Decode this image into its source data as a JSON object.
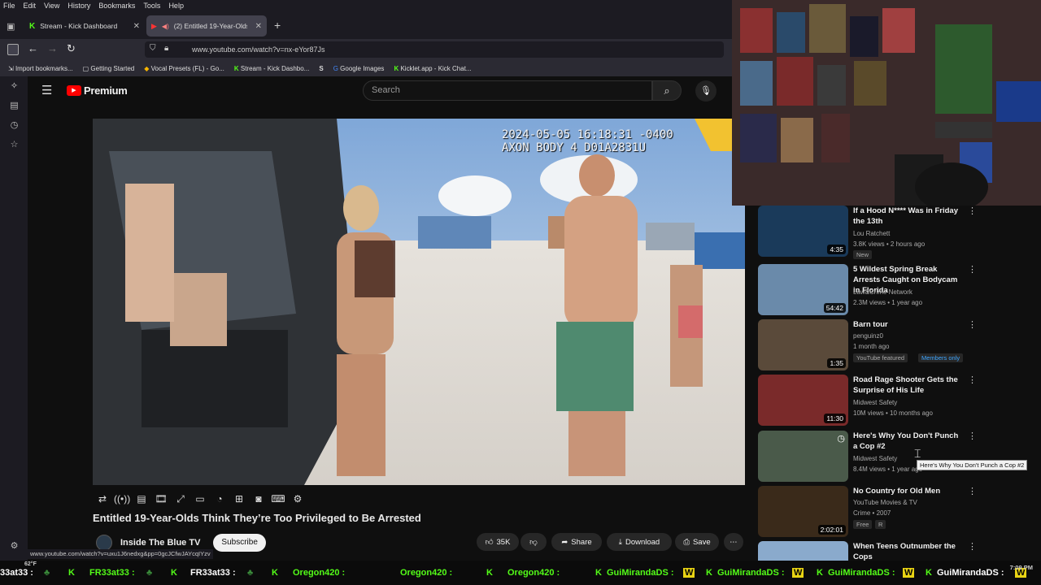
{
  "menubar": [
    "File",
    "Edit",
    "View",
    "History",
    "Bookmarks",
    "Tools",
    "Help"
  ],
  "tabs": [
    {
      "label": "Stream - Kick Dashboard"
    },
    {
      "label": "(2) Entitled 19-Year-Olds Th"
    }
  ],
  "url": "www.youtube.com/watch?v=nx-eYor87Js",
  "bookmarks": [
    "Import bookmarks...",
    "Getting Started",
    "Vocal Presets (FL) - Go...",
    "Stream - Kick Dashbo...",
    "Google Images",
    "Kicklet.app - Kick Chat..."
  ],
  "youtube": {
    "logo_text": "Premium",
    "search_placeholder": "Search"
  },
  "video": {
    "timestamp_line1": "2024-05-05 16:18:31 -0400",
    "timestamp_line2": "AXON BODY 4 D01A2831U",
    "title": "Entitled 19-Year-Olds Think They’re Too Privileged to Be Arrested",
    "channel": "Inside The Blue TV",
    "subscribe": "Subscribe",
    "likes": "35K",
    "share": "Share",
    "download": "Download",
    "save": "Save"
  },
  "status_url": "www.youtube.com/watch?v=uxu1J6nedxg&pp=0gcJCfwJAYcqIYzv",
  "recommendations": [
    {
      "title": "If a Hood N**** Was in Friday the 13th",
      "channel": "Lou Ratchett",
      "stats": "3.8K views • 2 hours ago",
      "duration": "4:35",
      "badge": "New"
    },
    {
      "title": "5 Wildest Spring Break Arrests Caught on Bodycam in Florida",
      "channel": "Law&Crime Network",
      "stats": "2.3M views • 1 year ago",
      "duration": "54:42",
      "badge": ""
    },
    {
      "title": "Barn tour",
      "channel": "penguinz0",
      "stats": "1 month ago",
      "duration": "1:35",
      "badge": "YouTube featured",
      "badge2": "Members only"
    },
    {
      "title": "Road Rage Shooter Gets the Surprise of His Life",
      "channel": "Midwest Safety",
      "stats": "10M views • 10 months ago",
      "duration": "11:30",
      "badge": ""
    },
    {
      "title": "Here's Why You Don't Punch a Cop #2",
      "channel": "Midwest Safety",
      "stats": "8.4M views • 1 year ago",
      "duration": "",
      "badge": ""
    },
    {
      "title": "No Country for Old Men",
      "channel": "YouTube Movies & TV",
      "stats": "Crime • 2007",
      "duration": "2:02:01",
      "badge": "Free",
      "badge2": "R"
    },
    {
      "title": "When Teens Outnumber the Cops",
      "channel": "",
      "stats": "",
      "duration": "",
      "badge": ""
    }
  ],
  "tooltip": "Here's Why You Don't Punch a Cop #2",
  "ticker": [
    {
      "user": "33at33 :",
      "color": "white"
    },
    {
      "user": "FR33at33 :",
      "color": "green"
    },
    {
      "user": "FR33at33 :",
      "color": "white"
    },
    {
      "user": "Oregon420 :",
      "color": "green"
    },
    {
      "user": "Oregon420 :",
      "color": "green"
    },
    {
      "user": "Oregon420 :",
      "color": "green"
    },
    {
      "user": "GuiMirandaDS :",
      "color": "green"
    },
    {
      "user": "GuiMirandaDS :",
      "color": "green"
    },
    {
      "user": "GuiMirandaDS :",
      "color": "green"
    },
    {
      "user": "GuiMirandaDS :",
      "color": "white"
    }
  ],
  "clock": {
    "time": "7:09 PM",
    "temp": "62°F"
  }
}
